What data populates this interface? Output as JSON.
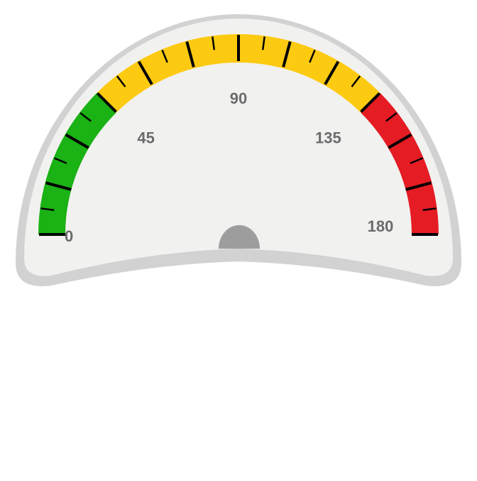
{
  "chart_data": {
    "type": "gauge",
    "title": "",
    "min": 0,
    "max": 180,
    "value": null,
    "major_step": 15,
    "minor_step": 7.5,
    "labels": [
      {
        "value": 0,
        "text": "0"
      },
      {
        "value": 45,
        "text": "45"
      },
      {
        "value": 90,
        "text": "90"
      },
      {
        "value": 135,
        "text": "135"
      },
      {
        "value": 180,
        "text": "180"
      }
    ],
    "bands": [
      {
        "from": 0,
        "to": 45,
        "color": "#1ab215"
      },
      {
        "from": 45,
        "to": 135,
        "color": "#fdca12"
      },
      {
        "from": 135,
        "to": 180,
        "color": "#e51c23"
      }
    ]
  },
  "style": {
    "face_color": "#f1f1f0",
    "frame_color": "#d2d2d2",
    "hub_color": "#9d9d9d",
    "tick_color": "#000000",
    "label_color": "#6b6b6b"
  }
}
